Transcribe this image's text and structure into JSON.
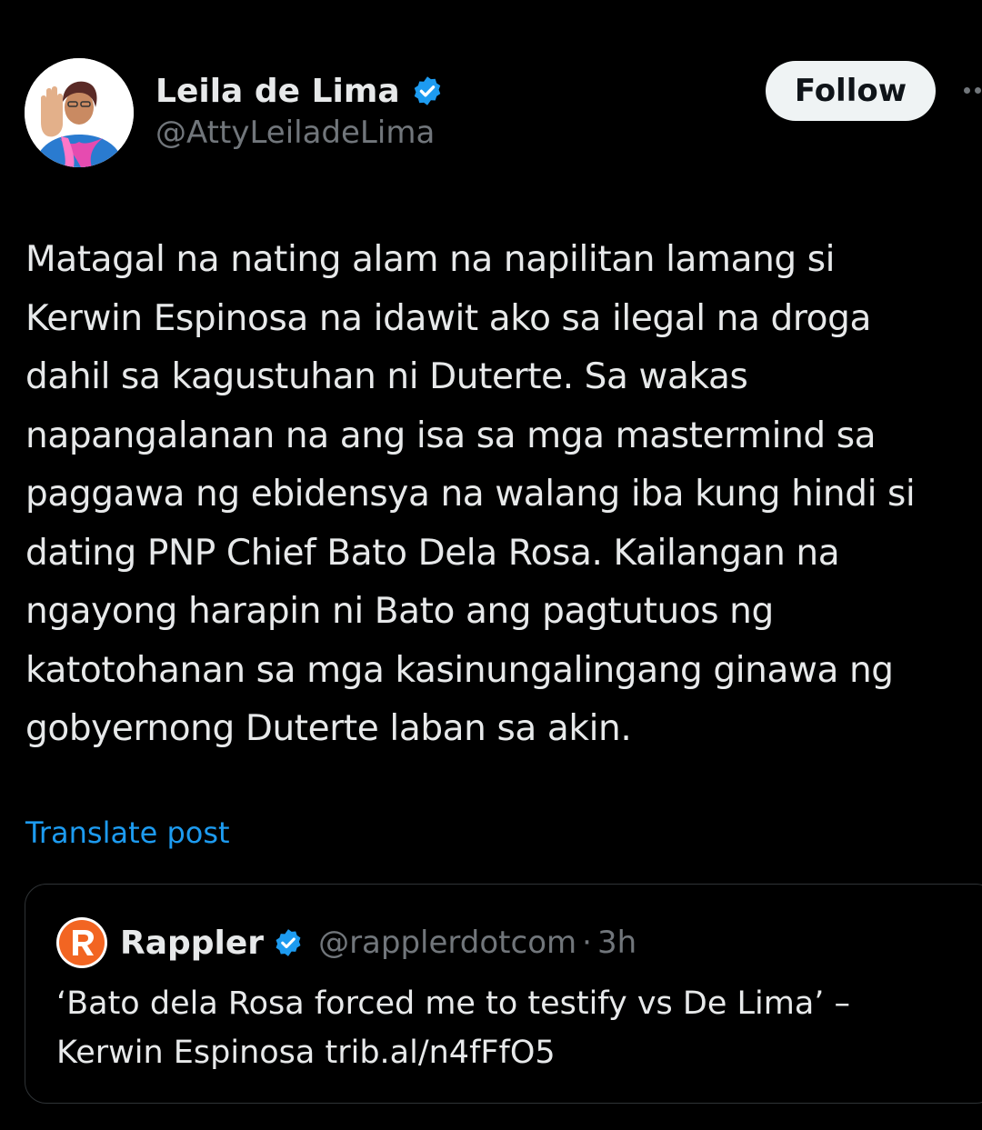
{
  "author": {
    "display_name": "Leila de Lima",
    "handle": "@AttyLeiladeLima",
    "verified": true
  },
  "follow_button": {
    "label": "Follow"
  },
  "post": {
    "lines": [
      "Matagal  na nating alam na napilitan lamang si",
      "Kerwin Espinosa na idawit ako sa ilegal na droga",
      "dahil sa kagustuhan ni Duterte. Sa wakas",
      "napangalanan na ang isa sa mga mastermind sa",
      "paggawa ng ebidensya na walang iba kung hindi si",
      "dating PNP Chief Bato Dela Rosa. Kailangan na",
      "ngayong harapin ni Bato ang pagtutuos ng",
      "katotohanan sa mga kasinungalingang ginawa ng",
      "gobyernong Duterte laban sa akin."
    ],
    "translate_label": "Translate post"
  },
  "quote": {
    "display_name": "Rappler",
    "handle": "@rapplerdotcom",
    "separator": "·",
    "time": "3h",
    "verified": true,
    "lines": [
      "‘Bato dela Rosa forced me to testify vs De Lima’ –",
      "Kerwin Espinosa trib.al/n4fFfO5"
    ]
  },
  "colors": {
    "background": "#000000",
    "primary_text": "#e7e9ea",
    "secondary_text": "#71767b",
    "link": "#1d9bf0",
    "verified_badge": "#1d9bf0",
    "follow_button_bg": "#eff3f4",
    "rappler_brand": "#f26522"
  },
  "icons": {
    "verified": "verified-badge-icon",
    "more": "more-horizontal-icon",
    "rappler_logo": "rappler-logo-icon"
  }
}
